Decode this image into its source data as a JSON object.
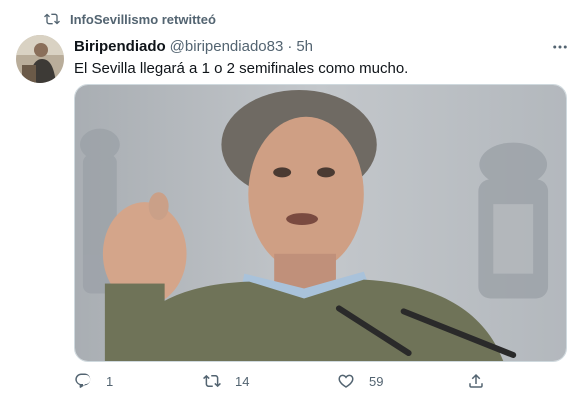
{
  "retweet": {
    "label": "InfoSevillismo retwitteó"
  },
  "author": {
    "display_name": "Biripendiado",
    "handle": "@biripendiado83",
    "dot": "·",
    "time": "5h"
  },
  "tweet": {
    "text": "El Sevilla llegará a 1 o 2 semifinales como mucho."
  },
  "actions": {
    "reply_count": "1",
    "retweet_count": "14",
    "like_count": "59"
  },
  "icons": [
    "retweet-icon",
    "more-icon",
    "reply-icon",
    "like-icon",
    "share-icon"
  ],
  "colors": {
    "secondary_text": "#536471",
    "primary_text": "#0f1419",
    "border": "#cfd9de"
  }
}
